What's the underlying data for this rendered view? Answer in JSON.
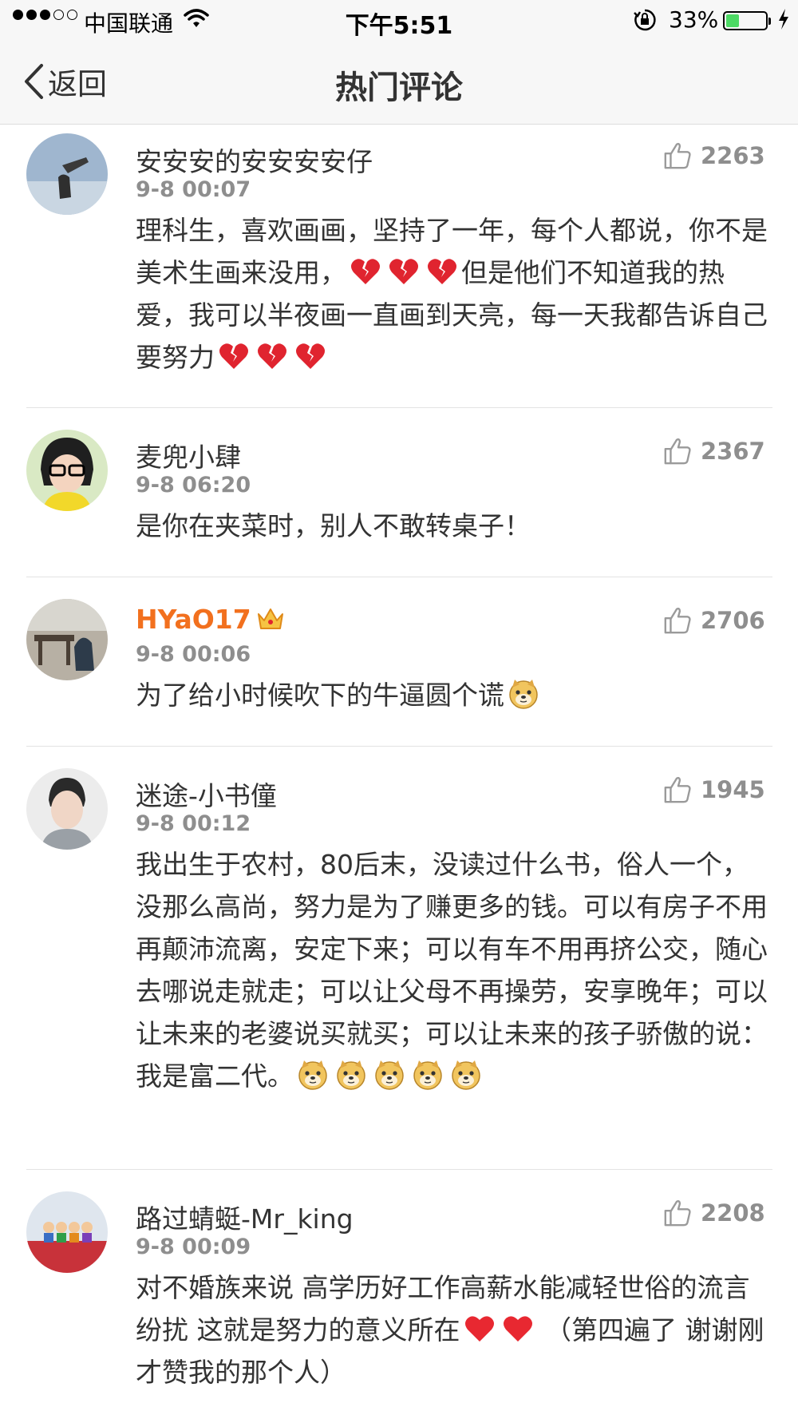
{
  "status_bar": {
    "carrier": "中国联通",
    "time": "下午5:51",
    "battery": "33%",
    "battery_level": 0.33,
    "signal_icon": "signal-dots-icon",
    "wifi_icon": "wifi-icon",
    "lock_icon": "orientation-lock-icon",
    "charging_icon": "charging-bolt-icon"
  },
  "nav": {
    "back_label": "返回",
    "title": "热门评论"
  },
  "colors": {
    "vip_name": "#f2701e",
    "meta_gray": "#8e8e8e",
    "heart_red": "#e0242f"
  },
  "comments": [
    {
      "name": "安安安的安安安安仔",
      "date": "9-8 00:07",
      "likes": "2263",
      "text_a": "理科生，喜欢画画，坚持了一年，每个人都说，你不是美术生画来没用，",
      "text_b": "但是他们不知道我的热爱，我可以半夜画一直画到天亮，每一天我都告诉自己要努力"
    },
    {
      "name": "麦兜小肆",
      "date": "9-8 06:20",
      "likes": "2367",
      "text": "是你在夹菜时，别人不敢转桌子！"
    },
    {
      "name": "HYaO17",
      "date": "9-8 00:06",
      "likes": "2706",
      "text": "为了给小时候吹下的牛逼圆个谎",
      "badge_icon": "vip-crown-icon"
    },
    {
      "name": "迷途-小书僮",
      "date": "9-8 00:12",
      "likes": "1945",
      "text": "我出生于农村，80后末，没读过什么书，俗人一个，没那么高尚，努力是为了赚更多的钱。可以有房子不用再颠沛流离，安定下来；可以有车不用再挤公交，随心去哪说走就走；可以让父母不再操劳，安享晚年；可以让未来的老婆说买就买；可以让未来的孩子骄傲的说：我是富二代。"
    },
    {
      "name": "路过蜻蜓-Mr_king",
      "date": "9-8 00:09",
      "likes": "2208",
      "text_a": "对不婚族来说 高学历好工作高薪水能减轻世俗的流言纷扰 这就是努力的意义所在",
      "text_b": " （第四遍了 谢谢刚才赞我的那个人）"
    }
  ]
}
